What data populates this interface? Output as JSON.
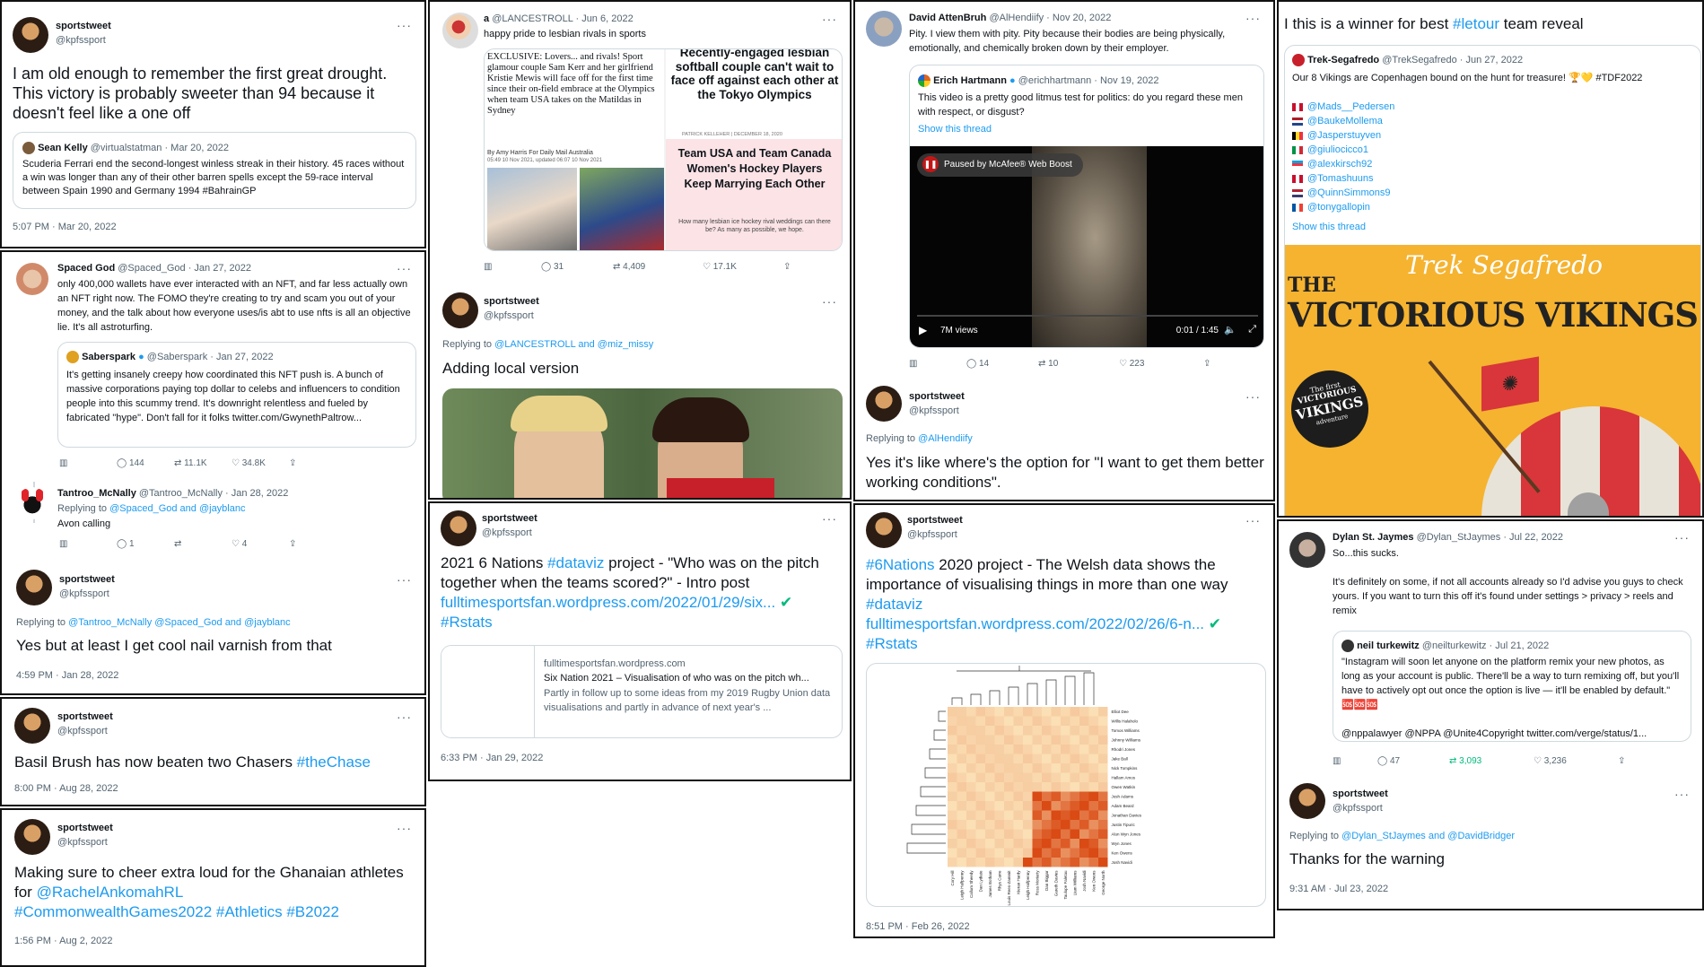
{
  "theme": {
    "link": "#1d9bf0",
    "verified": "#1d9bf0",
    "green": "#00ba7c"
  },
  "c1": {
    "name": "sportstweet",
    "handle": "@kpfssport",
    "text": "I am old enough to remember the first great drought. This victory is probably sweeter than 94 because it doesn't feel like a one off",
    "q_name": "Sean Kelly",
    "q_meta": "@virtualstatman · Mar 20, 2022",
    "q_text": "Scuderia Ferrari end the second-longest winless streak in their history.  45 races without a win was longer than any of their other barren spells except the 59-race interval between Spain 1990 and Germany 1994 #BahrainGP",
    "time": "5:07 PM · Mar 20, 2022"
  },
  "c2": {
    "name": "Spaced God",
    "meta": "@Spaced_God · Jan 27, 2022",
    "text": "only 400,000 wallets have ever interacted with an NFT, and far less actually own an NFT right now. The FOMO they're creating to try and scam you out of your money, and the talk about how everyone uses/is abt to use nfts is all an objective lie. It's all astroturfing.",
    "q_name": "Saberspark",
    "q_meta": "@Saberspark · Jan 27, 2022",
    "q_text": "It's getting insanely creepy how coordinated this NFT push is. A bunch of massive corporations paying top dollar to celebs and influencers to condition people into this scummy trend. It's downright relentless and fueled by fabricated \"hype\". Don't fall for it folks twitter.com/GwynethPaltrow...",
    "replies": "144",
    "rts": "11.1K",
    "likes": "34.8K",
    "t_name": "Tantroo_McNally",
    "t_meta": "@Tantroo_McNally · Jan 28, 2022",
    "t_reply": "Replying to",
    "t_reply_to": "@Spaced_God and @jayblanc",
    "t_text": "Avon calling",
    "t_replies": "1",
    "t_likes": "4",
    "s_name": "sportstweet",
    "s_handle": "@kpfssport",
    "s_reply": "Replying to",
    "s_reply_to": "@Tantroo_McNally @Spaced_God and @jayblanc",
    "s_text": "Yes but at least I get cool nail varnish from that",
    "time": "4:59 PM · Jan 28, 2022"
  },
  "c3": {
    "name": "sportstweet",
    "handle": "@kpfssport",
    "text": "Basil Brush has now beaten two Chasers ",
    "tag": "#theChase",
    "time": "8:00 PM · Aug 28, 2022"
  },
  "c4": {
    "name": "sportstweet",
    "handle": "@kpfssport",
    "text": "Making sure to cheer extra loud for the Ghanaian athletes for ",
    "l1": "@RachelAnkomahRL",
    "l2": "#CommonwealthGames2022 #Athletics #B2022",
    "time": "1:56 PM · Aug 2, 2022"
  },
  "c5": {
    "name": "a",
    "meta": "@LANCESTROLL · Jun 6, 2022",
    "text": "happy pride to lesbian rivals in sports",
    "img_left": "EXCLUSIVE: Lovers... and rivals! Sport glamour couple Sam Kerr and her girlfriend Kristie Mewis will face off for the first time since their on-field embrace at the Olympics when team USA takes on the Matildas in Sydney",
    "img_byline": "By Amy Harris For Daily Mail Australia",
    "img_date": "05:49 10 Nov 2021, updated 06:07 10 Nov 2021",
    "img_right1": "Recently-engaged lesbian softball couple can't wait to face off against each other at the Tokyo Olympics",
    "img_credit": "PATRICK KELLEHER  |  DECEMBER 18, 2020",
    "img_right2": "Team USA and Team Canada Women's Hockey Players Keep Marrying Each Other",
    "img_right3": "How many lesbian ice hockey rival weddings can there be? As many as possible, we hope.",
    "replies": "31",
    "rts": "4,409",
    "likes": "17.1K",
    "s_name": "sportstweet",
    "s_handle": "@kpfssport",
    "s_reply": "Replying to",
    "s_reply_to": "@LANCESTROLL and @miz_missy",
    "s_text": "Adding local version"
  },
  "c6": {
    "name": "sportstweet",
    "handle": "@kpfssport",
    "text": "2021 6 Nations ",
    "tag": "#dataviz",
    "text2": " project - \"Who was on the pitch together when the teams scored?\" - Intro post",
    "link": "fulltimesportsfan.wordpress.com/2022/01/29/six...",
    "tag2": "#Rstats",
    "lc_domain": "fulltimesportsfan.wordpress.com",
    "lc_title": "Six Nation 2021 – Visualisation of who was on the pitch wh...",
    "lc_desc": "Partly in follow up to some ideas from my 2019 Rugby Union data visualisations and partly in advance of next year's ...",
    "time": "6:33 PM · Jan 29, 2022"
  },
  "c7": {
    "name": "David AttenBruh",
    "meta": "@AlHendiify · Nov 20, 2022",
    "text": "Pity. I view them with pity. Pity because their bodies are being physically, emotionally, and chemically broken down by their employer.",
    "q_name": "Erich Hartmann",
    "q_meta": "@erichhartmann · Nov 19, 2022",
    "q_text": "This video is a pretty good litmus test for politics: do you regard these men with respect, or disgust?",
    "q_show": "Show this thread",
    "v_paused": "Paused by McAfee® Web Boost",
    "v_views": "7M views",
    "v_time": "0:01 / 1:45",
    "replies": "14",
    "rts": "10",
    "likes": "223",
    "s_name": "sportstweet",
    "s_handle": "@kpfssport",
    "s_reply": "Replying to",
    "s_reply_to": "@AlHendiify",
    "s_text": "Yes it's like where's the option for \"I want to get them better working conditions\"."
  },
  "c8": {
    "name": "sportstweet",
    "handle": "@kpfssport",
    "tag": "#6Nations",
    "text": " 2020 project - The Welsh data shows the importance of visualising things in more than one way",
    "tag2": "#dataviz",
    "link": "fulltimesportsfan.wordpress.com/2022/02/26/6-n...",
    "tag3": "#Rstats",
    "players": [
      "Elliot Dee",
      "Willis Halaholo",
      "Tomos Williams",
      "Johnny Williams",
      "Rhodri Jones",
      "Jake Ball",
      "Nick Tompkins",
      "Hallam Amos",
      "Owen Watkin",
      "Josh Adams",
      "Adam Beard",
      "Jonathan Davies",
      "Justin Tipuric",
      "Alun Wyn Jones",
      "Wyn Jones",
      "Ken Owens",
      "Josh Navidi"
    ],
    "players_x": [
      "Cory Hill",
      "Leigh Halfpenny",
      "Callum Sheedy",
      "Dan Lydiate",
      "James Botham",
      "Rhys Carre",
      "Louis Rees-Zammit",
      "Kieran Hardy",
      "Leigh Halfpenny",
      "Ross Moriarty",
      "Dan Biggar",
      "Gareth Davies",
      "Taulupe Faletau",
      "Liam Williams",
      "Josh Navidi",
      "Ken Owens",
      "George North"
    ],
    "time": "8:51 PM · Feb 26, 2022"
  },
  "c9": {
    "text": "I this is a winner for best ",
    "tag": "#letour",
    "text2": " team reveal",
    "q_name": "Trek-Segafredo",
    "q_meta": "@TrekSegafredo · Jun 27, 2022",
    "q_text": "Our 8 Vikings are Copenhagen bound on the hunt for treasure! 🏆💛 #TDF2022",
    "riders": [
      "@Mads__Pedersen",
      "@BaukeMollema",
      "@Jasperstuyven",
      "@giuliocicco1",
      "@alexkirsch92",
      "@Tomashuuns",
      "@QuinnSimmons9",
      "@tonygallopin"
    ],
    "flag_colors": [
      [
        "#c8102e",
        "#fff",
        "#c8102e"
      ],
      [
        "#ae1c28",
        "#fff",
        "#21468b"
      ],
      [
        "#000",
        "#fdda24",
        "#ef3340"
      ],
      [
        "#009246",
        "#fff",
        "#ce2b37"
      ],
      [
        "#00a3e0",
        "#ef3340",
        "#fff"
      ],
      [
        "#c8102e",
        "#fff",
        "#c8102e"
      ],
      [
        "#b22234",
        "#fff",
        "#3c3b6e"
      ],
      [
        "#0055a4",
        "#fff",
        "#ef4135"
      ]
    ],
    "q_show": "Show this thread",
    "poster_script": "Trek Segafredo",
    "poster_the": "THE",
    "poster_title": "VICTORIOUS VIKINGS",
    "badge1": "The first",
    "badge2": "VICTORIOUS",
    "badge3": "VIKINGS",
    "badge4": "adventure"
  },
  "c10": {
    "name": "Dylan St. Jaymes",
    "meta": "@Dylan_StJaymes · Jul 22, 2022",
    "text": "So...this sucks.\n\nIt's definitely on some, if not all accounts already so I'd advise you guys to check yours. If you want to turn this off it's found under settings > privacy > reels and remix",
    "q_name": "neil turkewitz",
    "q_meta": "@neilturkewitz · Jul 21, 2022",
    "q_text": "\"Instagram will soon let anyone on the platform remix your new photos, as long as your account is public. There'll be a way to turn remixing off, but you'll have to actively opt out once the option is live — it'll be enabled by default.\" 🆘🆘🆘\n\n@nppalawyer @NPPA @Unite4Copyright twitter.com/verge/status/1...",
    "replies": "47",
    "rts": "3,093",
    "likes": "3,236",
    "s_name": "sportstweet",
    "s_handle": "@kpfssport",
    "s_reply": "Replying to",
    "s_reply_to": "@Dylan_StJaymes and @DavidBridger",
    "s_text": "Thanks for the warning",
    "time": "9:31 AM · Jul 23, 2022"
  }
}
